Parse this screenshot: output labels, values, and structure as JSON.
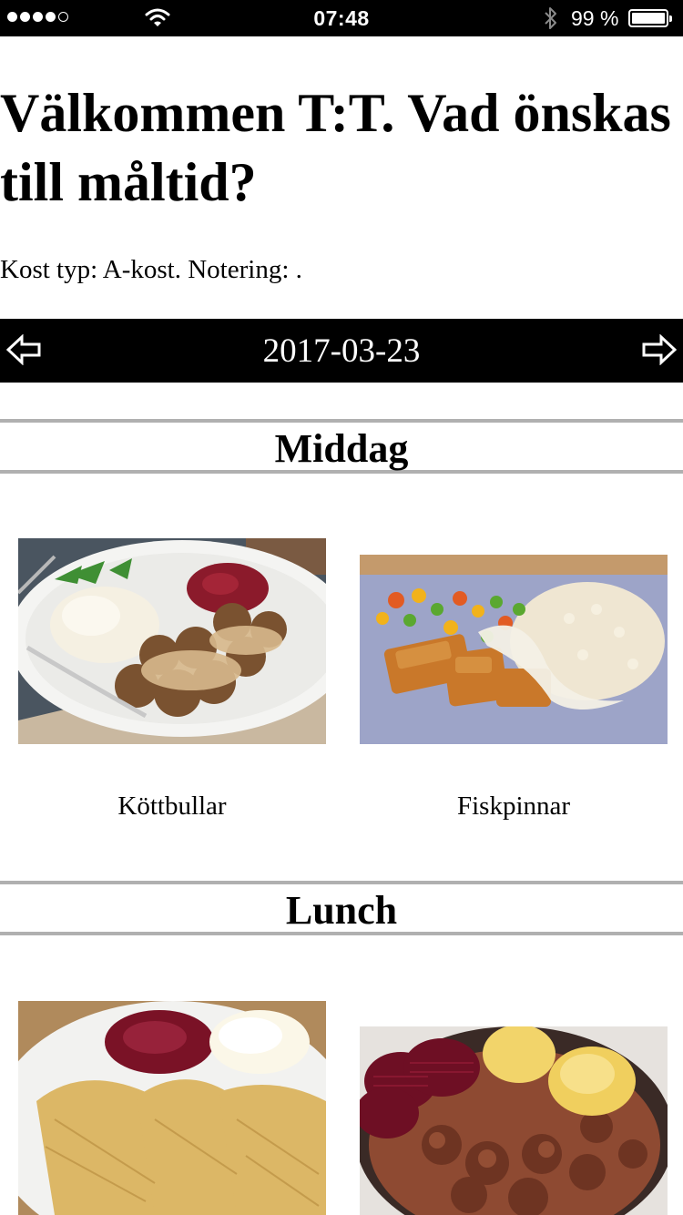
{
  "status_bar": {
    "signal_bars": 5,
    "signal_filled": 4,
    "time": "07:48",
    "battery_text": "99 %",
    "battery_level": 0.99,
    "icons": [
      "signal-dots",
      "wifi-icon",
      "bluetooth-icon",
      "battery-icon"
    ]
  },
  "header": {
    "welcome": "Välkommen T:T. Vad önskas till måltid?",
    "diet_note": "Kost typ: A-kost. Notering: ."
  },
  "date_nav": {
    "date": "2017-03-23",
    "prev_icon": "arrow-left-icon",
    "next_icon": "arrow-right-icon"
  },
  "sections": [
    {
      "title": "Middag",
      "meals": [
        {
          "name": "Köttbullar",
          "image": "meatballs-photo"
        },
        {
          "name": "Fiskpinnar",
          "image": "fish-sticks-photo"
        }
      ]
    },
    {
      "title": "Lunch",
      "meals": [
        {
          "name": "",
          "image": "pancakes-photo"
        },
        {
          "name": "",
          "image": "stew-photo"
        }
      ]
    }
  ],
  "colors": {
    "bar_background": "#000000",
    "bar_text": "#ffffff",
    "divider": "#b0b0b0",
    "page_background": "#ffffff"
  }
}
